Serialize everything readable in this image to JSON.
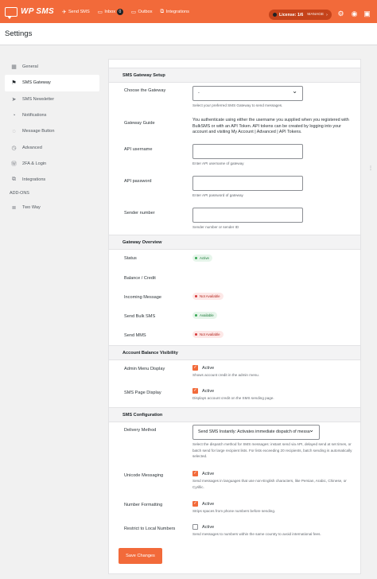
{
  "brand": {
    "name": "WP SMS"
  },
  "nav": [
    {
      "icon": "paper-plane-icon",
      "glyph": "✈",
      "label": "Send SMS"
    },
    {
      "icon": "inbox-icon",
      "glyph": "▭",
      "label": "Inbox",
      "badge": "0"
    },
    {
      "icon": "outbox-icon",
      "glyph": "▭",
      "label": "Outbox"
    },
    {
      "icon": "plug-icon",
      "glyph": "⧉",
      "label": "Integrations"
    }
  ],
  "license": {
    "label": "License: 1/6",
    "manage": "MANAGE"
  },
  "page": {
    "title": "Settings"
  },
  "sidebar": {
    "items": [
      {
        "label": "General",
        "icon": "grid-icon",
        "glyph": "▦",
        "active": false
      },
      {
        "label": "SMS Gateway",
        "icon": "flag-icon",
        "glyph": "⚑",
        "active": true
      },
      {
        "label": "SMS Newsletter",
        "icon": "send-icon",
        "glyph": "➤",
        "active": false
      },
      {
        "label": "Notifications",
        "icon": "bell-icon",
        "glyph": "◔",
        "active": false
      },
      {
        "label": "Message Button",
        "icon": "chat-icon",
        "glyph": "◌",
        "active": false
      },
      {
        "label": "Advanced",
        "icon": "gauge-icon",
        "glyph": "◷",
        "active": false
      },
      {
        "label": "2FA & Login",
        "icon": "wordpress-icon",
        "glyph": "Ⓦ",
        "active": false
      },
      {
        "label": "Integrations",
        "icon": "puzzle-icon",
        "glyph": "⧉",
        "active": false
      }
    ],
    "addons_label": "ADD-ONS",
    "addons": [
      {
        "label": "Two Way",
        "icon": "layers-icon",
        "glyph": "≣"
      }
    ]
  },
  "gateway_setup": {
    "heading": "SMS Gateway Setup",
    "choose_label": "Choose the Gateway",
    "choose_value": "-",
    "choose_help": "Select your preferred SMS Gateway to send messages.",
    "guide_label": "Gateway Guide",
    "guide_text": "You authenticate using either the username you supplied when you registered with BulkSMS or with an API Token. API tokens can be created by logging into your account and visiting My Account | Advanced | API Tokens.",
    "username_label": "API username",
    "username_help": "Enter API username of gateway",
    "password_label": "API password",
    "password_help": "Enter API password of gateway",
    "sender_label": "Sender number",
    "sender_help": "Sender number or sender ID"
  },
  "gateway_overview": {
    "heading": "Gateway Overview",
    "rows": [
      {
        "label": "Status",
        "pill": "Active",
        "kind": "ok"
      },
      {
        "label": "Balance / Credit",
        "pill": "",
        "kind": "none"
      },
      {
        "label": "Incoming Message",
        "pill": "Not Available",
        "kind": "bad"
      },
      {
        "label": "Send Bulk SMS",
        "pill": "Available",
        "kind": "ok"
      },
      {
        "label": "Send MMS",
        "pill": "Not Available",
        "kind": "bad"
      }
    ]
  },
  "balance_visibility": {
    "heading": "Account Balance Visibility",
    "admin_label": "Admin Menu Display",
    "admin_check": "Active",
    "admin_checked": true,
    "admin_help": "Shows account credit in the admin menu.",
    "page_label": "SMS Page Display",
    "page_check": "Active",
    "page_checked": true,
    "page_help": "Displays account credit on the SMS sending page."
  },
  "configuration": {
    "heading": "SMS Configuration",
    "delivery_label": "Delivery Method",
    "delivery_value": "Send SMS Instantly: Activates immediate dispatch of messa",
    "delivery_help": "Select the dispatch method for SMS messages: instant send via API, delayed send at set times, or batch send for large recipient lists. For lists exceeding 20 recipients, batch sending is automatically selected.",
    "unicode_label": "Unicode Messaging",
    "unicode_check": "Active",
    "unicode_checked": true,
    "unicode_help": "Send messages in languages that use non-English characters, like Persian, Arabic, Chinese, or Cyrillic.",
    "format_label": "Number Formatting",
    "format_check": "Active",
    "format_checked": true,
    "format_help": "Strips spaces from phone numbers before sending.",
    "restrict_label": "Restrict to Local Numbers",
    "restrict_check": "Active",
    "restrict_checked": false,
    "restrict_help": "Send messages to numbers within the same country to avoid international fees."
  },
  "save_button": "Save Changes",
  "colors": {
    "brand": "#f26a3a",
    "ok": "#36a853",
    "bad": "#d63638"
  }
}
